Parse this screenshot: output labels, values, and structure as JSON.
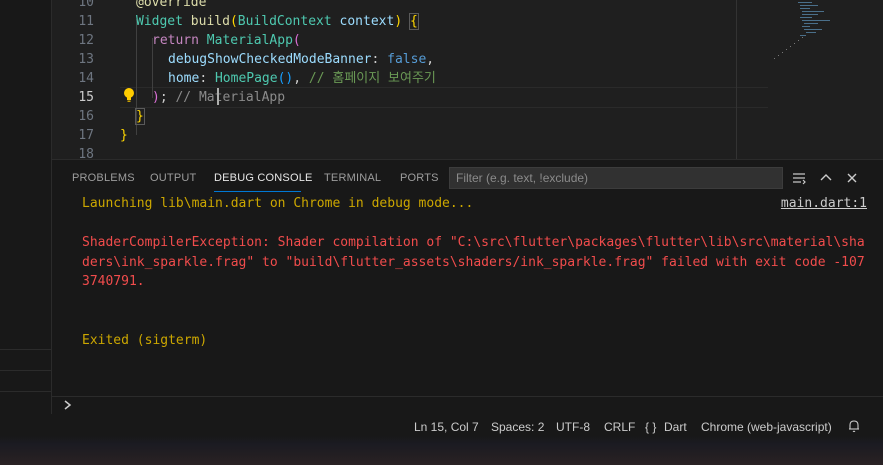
{
  "editor": {
    "lines": [
      {
        "num": "10",
        "active": false
      },
      {
        "num": "11",
        "active": false
      },
      {
        "num": "12",
        "active": false
      },
      {
        "num": "13",
        "active": false
      },
      {
        "num": "14",
        "active": false
      },
      {
        "num": "15",
        "active": true
      },
      {
        "num": "16",
        "active": false
      },
      {
        "num": "17",
        "active": false
      },
      {
        "num": "18",
        "active": false
      }
    ],
    "code": {
      "override": "@override",
      "widget_type": "Widget",
      "build_fn": "build",
      "build_ctx_type": "BuildContext",
      "build_ctx_param": "context",
      "return_kw": "return",
      "material_app": "MaterialApp",
      "debug_prop": "debugShowCheckedModeBanner",
      "false_kw": "false",
      "home_prop": "home",
      "homepage_fn": "HomePage",
      "comment_home": "// 홈페이지 보여주기",
      "comment_material": "// MaterialApp"
    }
  },
  "panel": {
    "tabs": [
      {
        "label": "PROBLEMS"
      },
      {
        "label": "OUTPUT"
      },
      {
        "label": "DEBUG CONSOLE"
      },
      {
        "label": "TERMINAL"
      },
      {
        "label": "PORTS"
      }
    ],
    "active_tab": "DEBUG CONSOLE",
    "filter_placeholder": "Filter (e.g. text, !exclude)",
    "console": {
      "launching": "Launching lib\\main.dart on Chrome in debug mode...",
      "source_link": "main.dart:1",
      "error": "ShaderCompilerException: Shader compilation of \"C:\\src\\flutter\\packages\\flutter\\lib\\src\\material\\shaders\\ink_sparkle.frag\" to \"build\\flutter_assets\\shaders/ink_sparkle.frag\" failed with exit code -1073740791.",
      "exited": "Exited (sigterm)"
    }
  },
  "status_bar": {
    "position": "Ln 15, Col 7",
    "spaces": "Spaces: 2",
    "encoding": "UTF-8",
    "eol": "CRLF",
    "language_icon": "{ }",
    "language": "Dart",
    "device": "Chrome (web-javascript)"
  },
  "colors": {
    "error": "#f14c4c",
    "info": "#cca700",
    "accent": "#0078d4"
  }
}
